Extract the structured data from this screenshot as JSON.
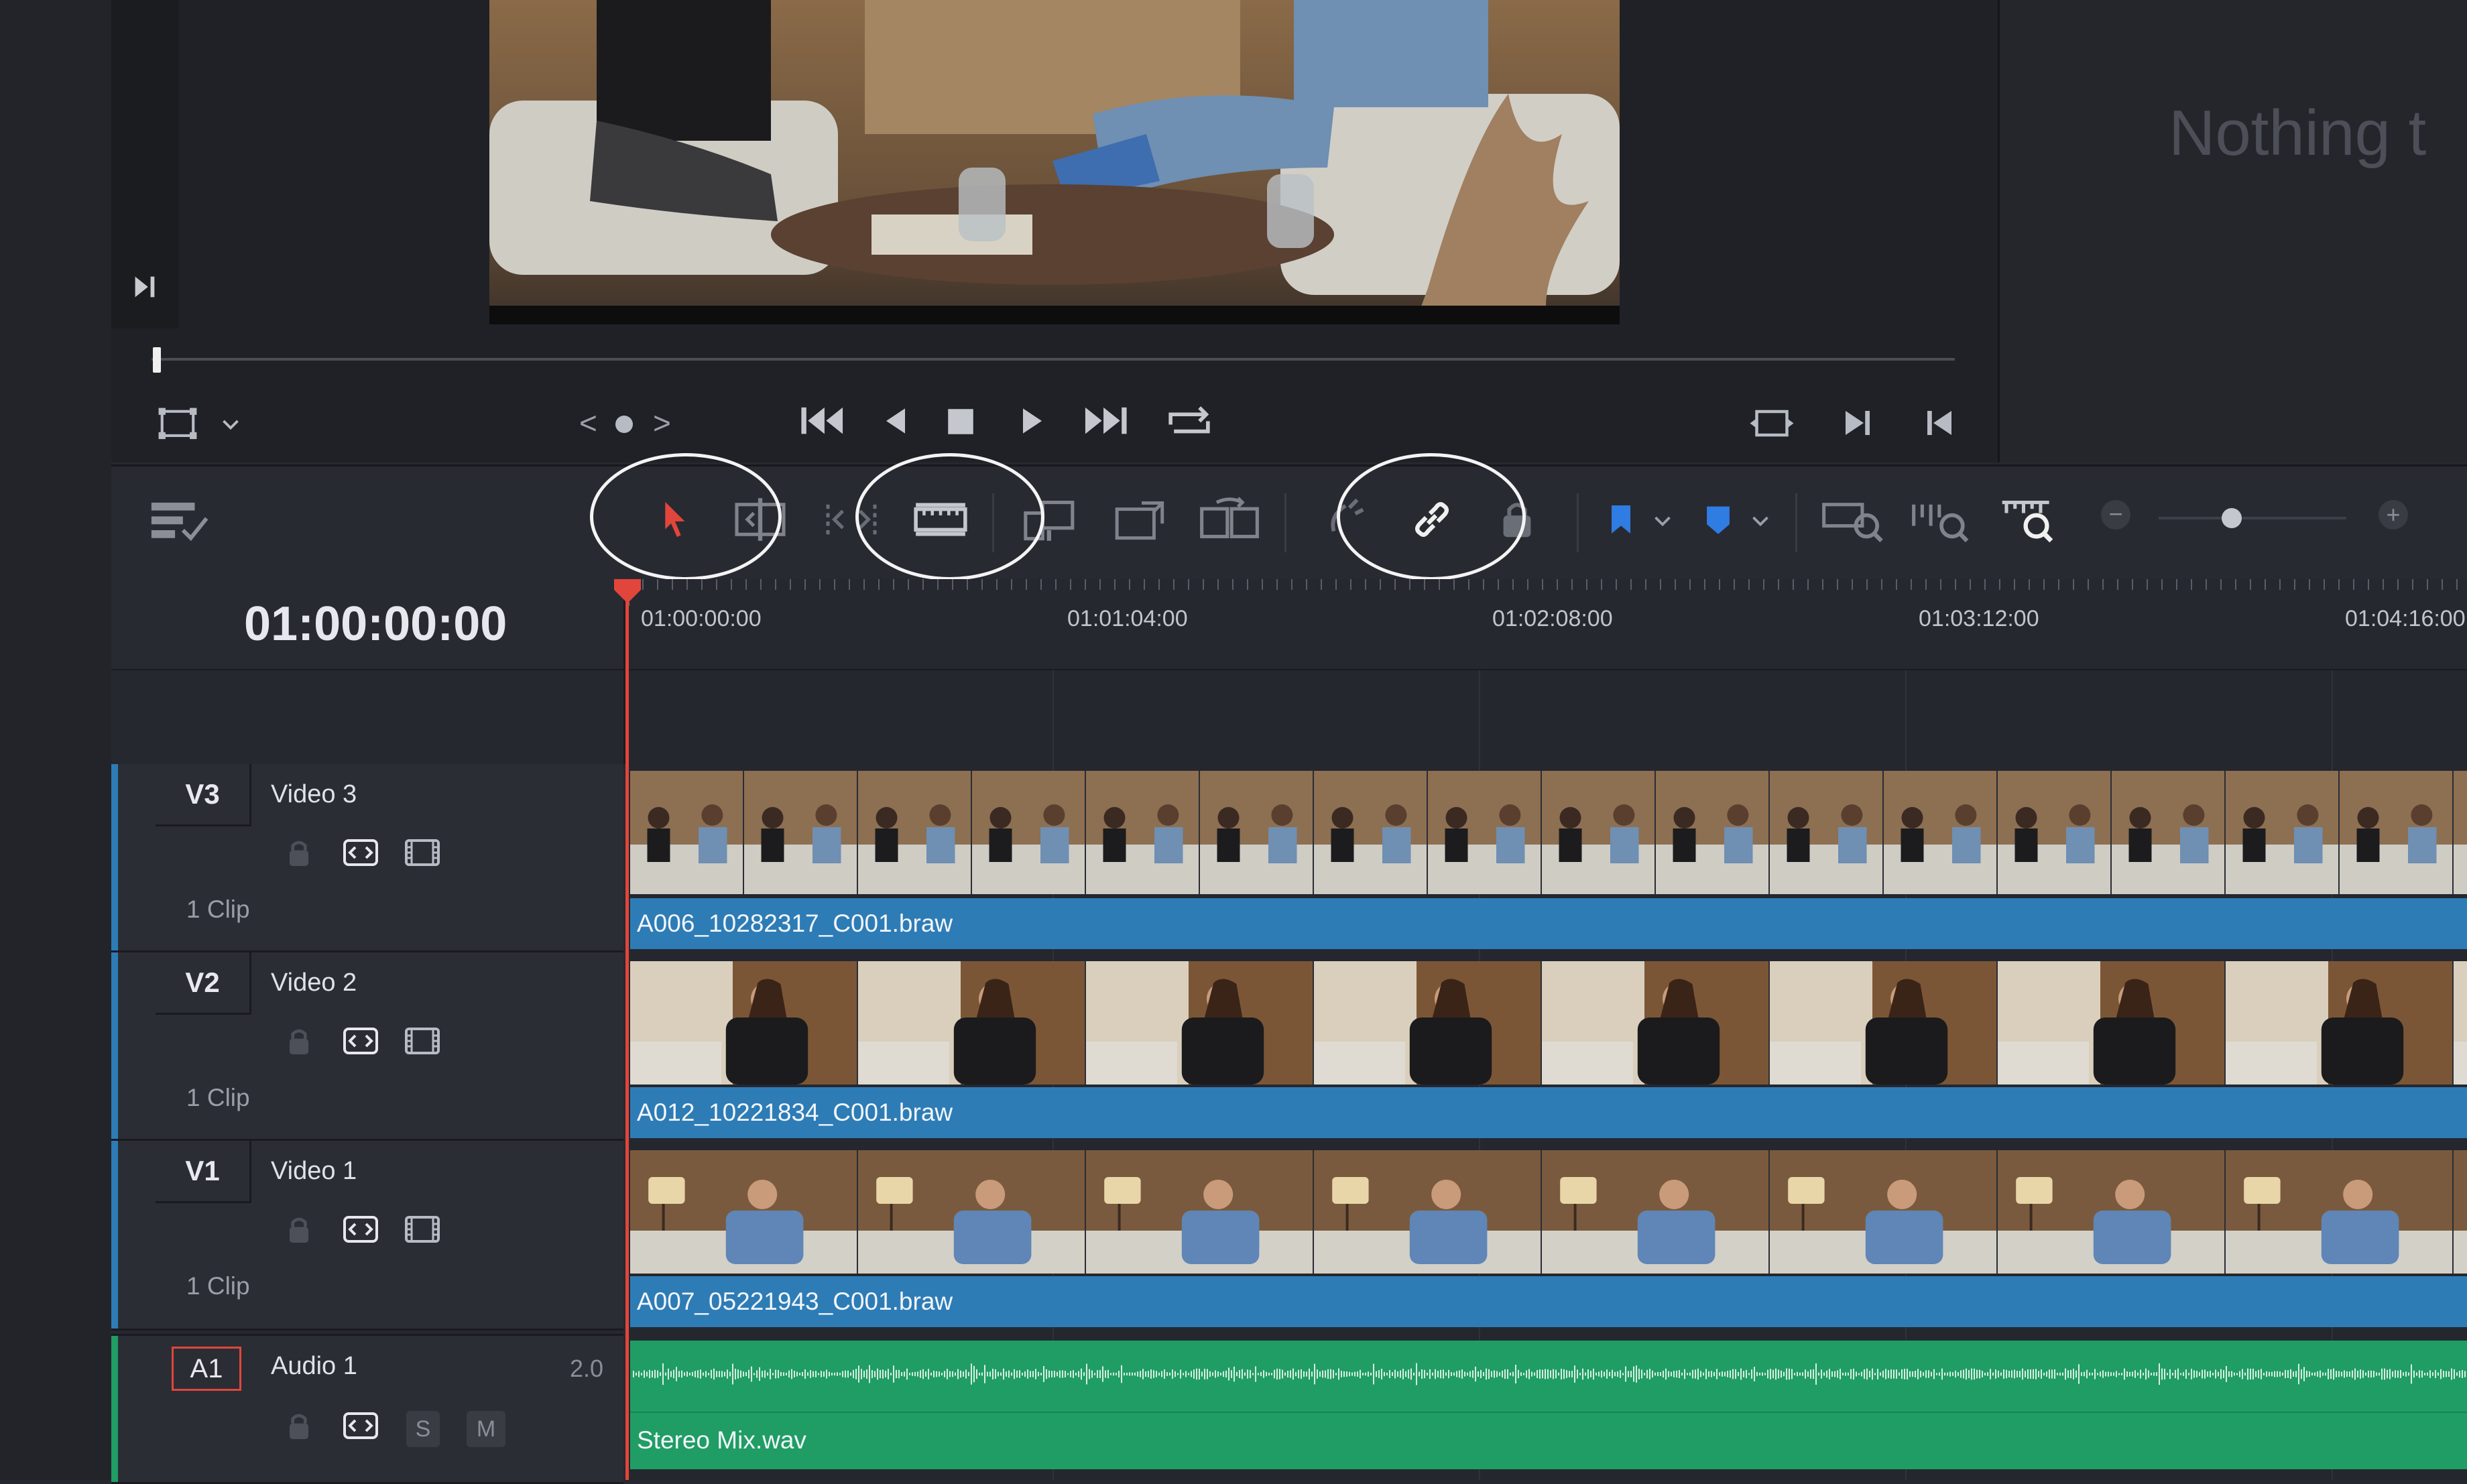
{
  "colors": {
    "background": "#262830",
    "viewer_bg": "#1d1f24",
    "clip_video": "#2e7cb6",
    "clip_audio": "#1f9d64",
    "playhead": "#e2453b",
    "marker_blue": "#2f7ce3",
    "annotation": "#f4f4f4"
  },
  "viewer": {
    "right_panel_text": "Nothing t",
    "scrub_position": 0.0,
    "controls": {
      "viewer_mode_icon": "crop-frame-icon",
      "jog_prev": "<",
      "jog_next": ">"
    }
  },
  "transport": {
    "icons": [
      "skip-to-start-icon",
      "play-reverse-icon",
      "stop-icon",
      "play-icon",
      "skip-to-end-icon",
      "loop-icon"
    ],
    "right_icons": [
      "match-frame-icon",
      "next-edit-icon",
      "prev-edit-icon"
    ]
  },
  "toolbar": {
    "icons": [
      "timeline-options-icon",
      "selection-mode-icon",
      "trim-edit-icon",
      "dynamic-trim-icon",
      "blade-edit-icon",
      "insert-clip-icon",
      "overwrite-clip-icon",
      "replace-clip-icon",
      "snapping-icon",
      "linked-selection-icon",
      "position-lock-icon",
      "flag-icon",
      "marker-icon",
      "zoom-full-icon",
      "zoom-detail-icon",
      "zoom-custom-icon"
    ],
    "zoom_minus": "−",
    "zoom_plus": "+",
    "zoom_level": 0.4
  },
  "timecode": "01:00:00:00",
  "ruler": {
    "labels": [
      "01:00:00:00",
      "01:01:04:00",
      "01:02:08:00",
      "01:03:12:00",
      "01:04:16:00"
    ]
  },
  "tracks": [
    {
      "id": "V3",
      "name": "Video 3",
      "clip_count": "1 Clip",
      "clip_name": "A006_10282317_C001.braw",
      "thumb": "two-shot"
    },
    {
      "id": "V2",
      "name": "Video 2",
      "clip_count": "1 Clip",
      "clip_name": "A012_10221834_C001.braw",
      "thumb": "woman"
    },
    {
      "id": "V1",
      "name": "Video 1",
      "clip_count": "1 Clip",
      "clip_name": "A007_05221943_C001.braw",
      "thumb": "man"
    }
  ],
  "audio_track": {
    "id": "A1",
    "name": "Audio 1",
    "channels": "2.0",
    "solo": "S",
    "mute": "M",
    "clip_name": "Stereo Mix.wav"
  }
}
